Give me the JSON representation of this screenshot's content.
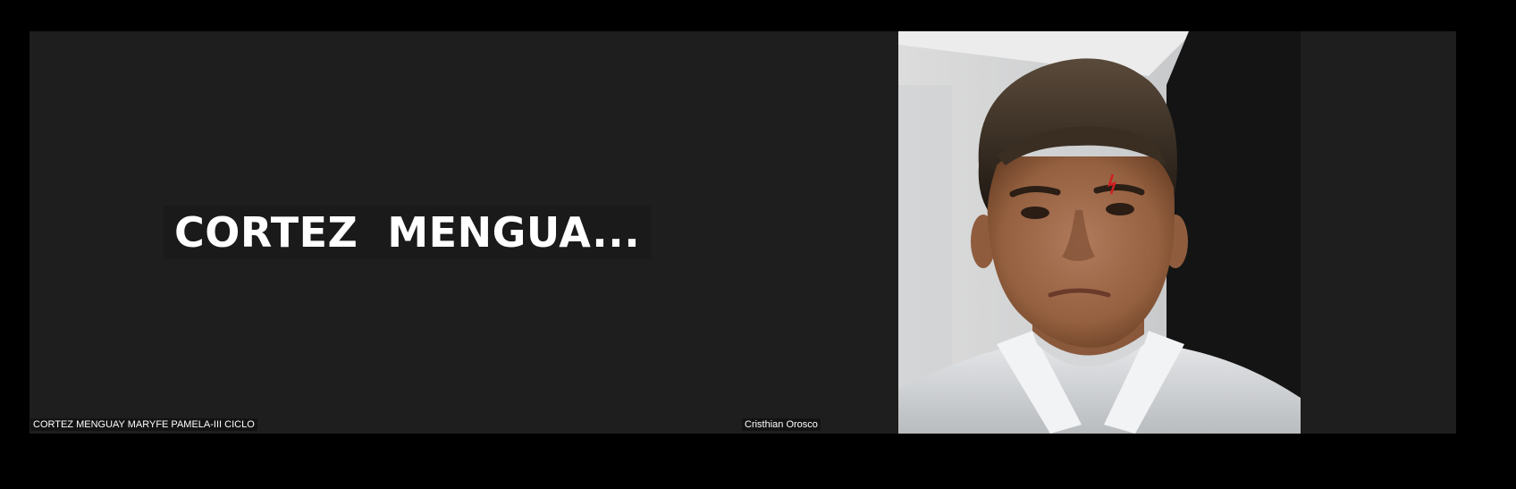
{
  "meeting": {
    "tiles": [
      {
        "display_name": "CORTEZ  MENGUA...",
        "label": "CORTEZ MENGUAY MARYFE PAMELA-III CICLO",
        "camera": "off"
      },
      {
        "label": "Cristhian Orosco",
        "camera": "on"
      }
    ]
  },
  "colors": {
    "background": "#000000",
    "tile_background": "#1e1e1e",
    "text": "#ffffff"
  }
}
